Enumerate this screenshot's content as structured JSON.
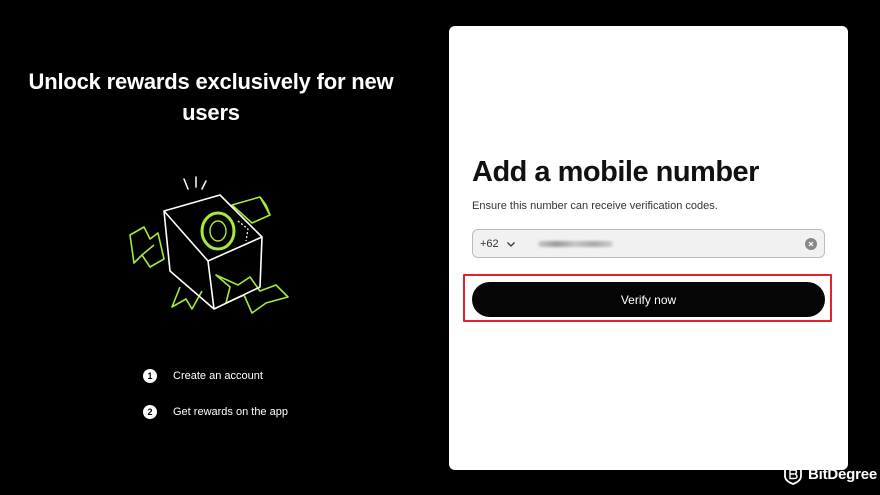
{
  "hero": {
    "title": "Unlock rewards exclusively for new users"
  },
  "steps": [
    {
      "number": "1",
      "label": "Create an account"
    },
    {
      "number": "2",
      "label": "Get rewards on the app"
    }
  ],
  "form": {
    "title": "Add a mobile number",
    "subtitle": "Ensure this number can receive verification codes.",
    "country_code": "+62",
    "phone_value": "(redacted)",
    "verify_label": "Verify now"
  },
  "watermark": {
    "brand": "BitDegree"
  },
  "colors": {
    "accent_green": "#a6ea3c",
    "highlight_red": "#e1232c",
    "button_dark": "#050505"
  },
  "icons": [
    "gift-box-illustration",
    "chevron-down-icon",
    "clear-icon",
    "bitdegree-logo-icon"
  ]
}
